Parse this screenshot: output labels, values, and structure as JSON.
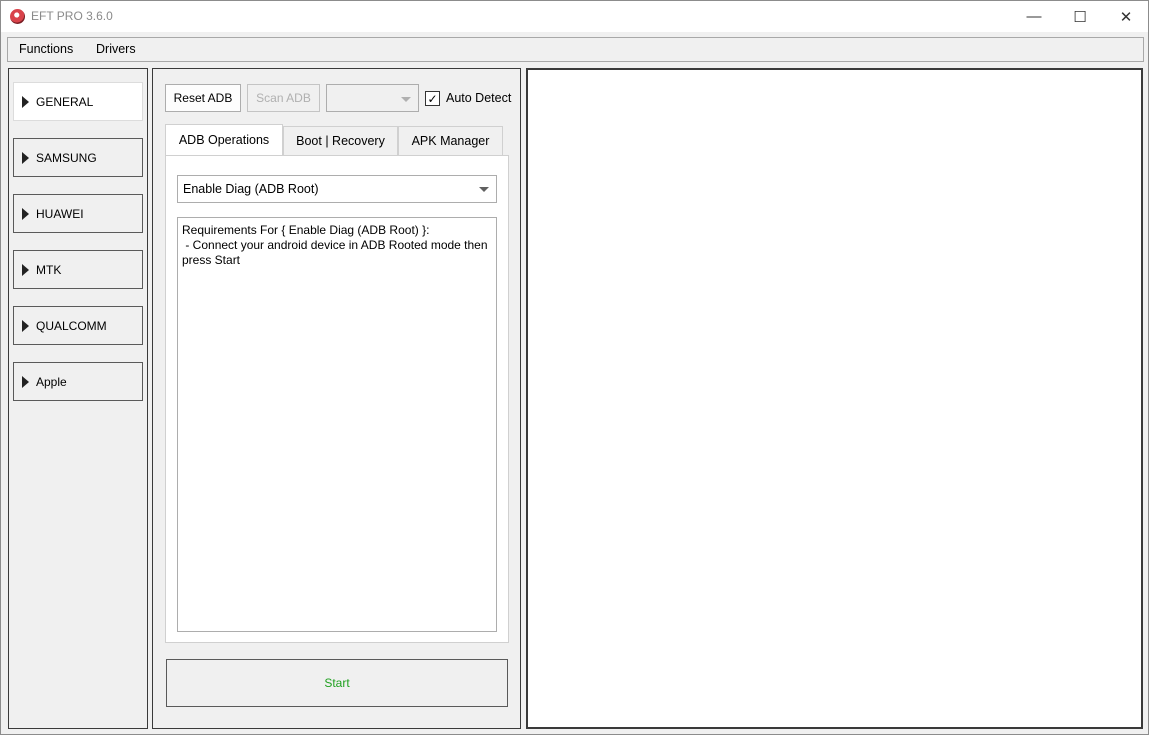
{
  "window": {
    "title": "EFT PRO 3.6.0",
    "controls": {
      "minimize_icon": "—",
      "maximize_icon": "☐",
      "close_icon": "✕"
    }
  },
  "menu": {
    "items": [
      "Functions",
      "Drivers"
    ]
  },
  "sidebar": {
    "items": [
      {
        "label": "GENERAL",
        "active": true
      },
      {
        "label": "SAMSUNG",
        "active": false
      },
      {
        "label": "HUAWEI",
        "active": false
      },
      {
        "label": "MTK",
        "active": false
      },
      {
        "label": "QUALCOMM",
        "active": false
      },
      {
        "label": "Apple",
        "active": false
      }
    ]
  },
  "toolbar": {
    "reset_adb": "Reset ADB",
    "scan_adb": "Scan ADB",
    "device_select_value": "",
    "auto_detect_label": "Auto Detect",
    "auto_detect_checked": true
  },
  "tabs": [
    "ADB Operations",
    "Boot | Recovery",
    "APK Manager"
  ],
  "operation": {
    "selected": "Enable Diag (ADB Root)",
    "requirements_line1": "Requirements For { Enable Diag (ADB Root) }:",
    "requirements_line2": " - Connect your android device in ADB Rooted mode then press Start"
  },
  "start_button": {
    "label": "Start",
    "color": "#1fa01f"
  }
}
